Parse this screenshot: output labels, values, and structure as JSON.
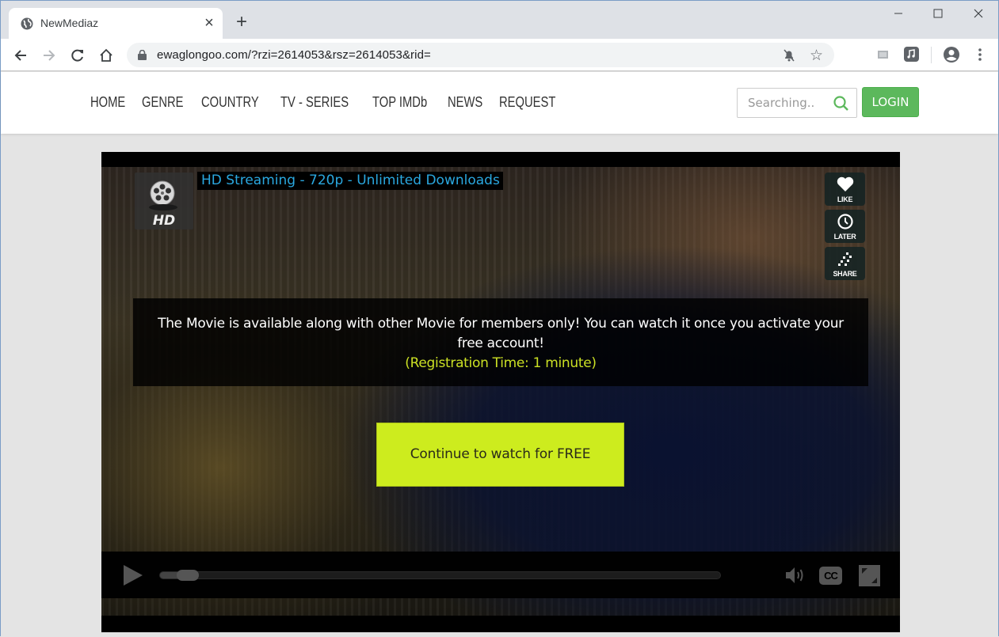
{
  "browser": {
    "tab": {
      "title": "NewMediaz",
      "icon": "globe-icon",
      "close_label": "×"
    },
    "new_tab_label": "+",
    "window_controls": {
      "minimize": "—",
      "maximize": "☐",
      "close": "✕"
    },
    "address": {
      "url": "ewaglongoo.com/?rzi=2614053&rsz=2614053&rid="
    },
    "toolbar_icons": [
      "back-icon",
      "forward-icon",
      "reload-icon",
      "home-icon",
      "lock-icon",
      "notifications-blocked-icon",
      "bookmark-star-icon",
      "extension-icon",
      "media-icon",
      "profile-icon",
      "menu-icon"
    ]
  },
  "site": {
    "nav": [
      "HOME",
      "GENRE",
      "COUNTRY",
      "TV - SERIES",
      "TOP IMDb",
      "NEWS",
      "REQUEST"
    ],
    "search": {
      "placeholder": "Searching.."
    },
    "login_label": "LOGIN",
    "accent_color": "#5cb85c"
  },
  "player": {
    "logo_text": "HD",
    "headline": "HD Streaming - 720p - Unlimited Downloads",
    "side_buttons": [
      {
        "label": "LIKE",
        "icon": "heart-icon"
      },
      {
        "label": "LATER",
        "icon": "clock-icon"
      },
      {
        "label": "SHARE",
        "icon": "share-icon"
      }
    ],
    "message": "The Movie is available along with other Movie for members only! You can watch it once you activate your free account!",
    "registration_note": "(Registration Time: 1 minute)",
    "cta_label": "Continue to watch for FREE",
    "cta_color": "#cdec1e",
    "progress_fraction": 0.03,
    "controls": {
      "cc_label": "CC"
    }
  }
}
